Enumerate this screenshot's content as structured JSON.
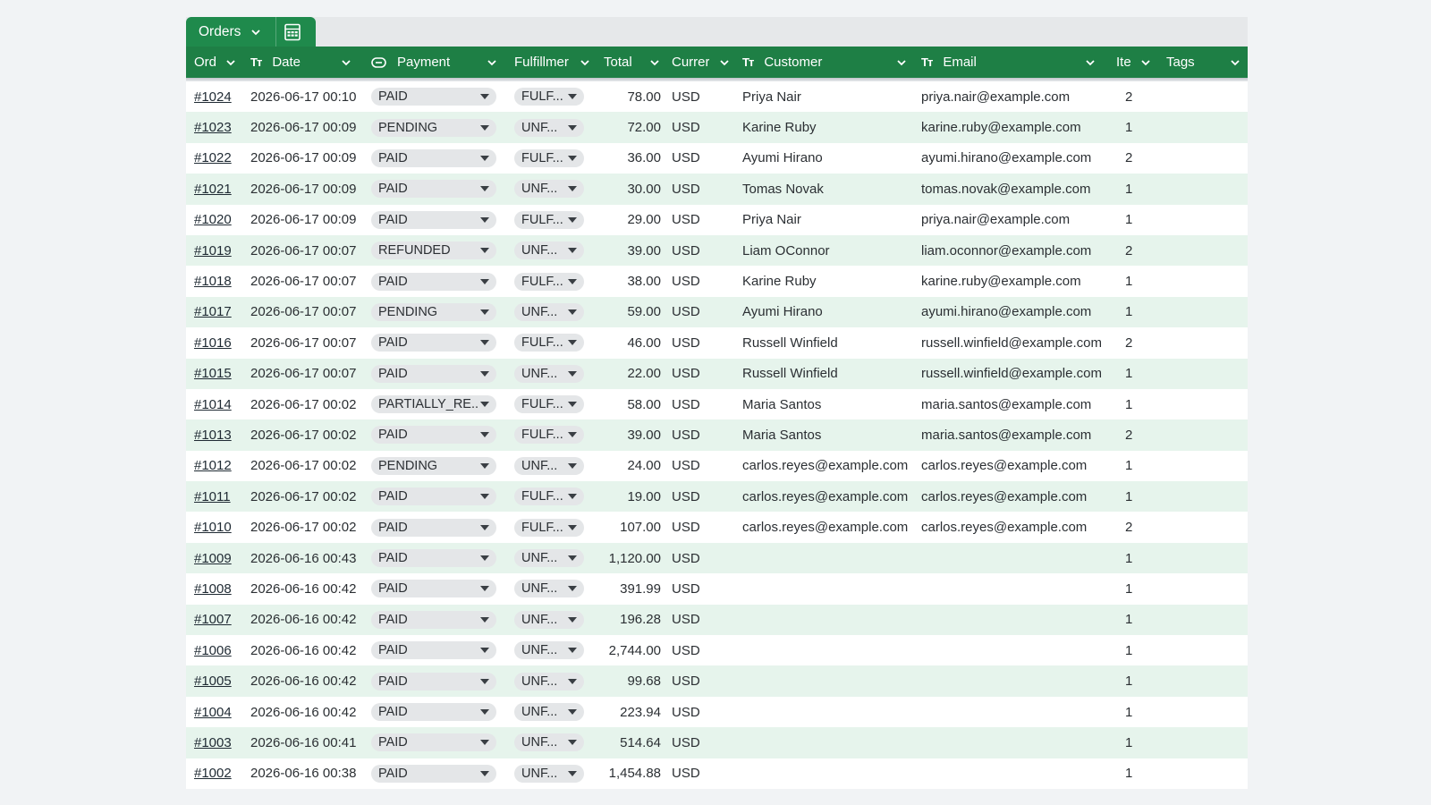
{
  "sheet_tab": {
    "label": "Orders"
  },
  "columns": [
    {
      "key": "order",
      "label": "Ord"
    },
    {
      "key": "date",
      "label": "Date"
    },
    {
      "key": "payment",
      "label": "Payment"
    },
    {
      "key": "fulfillment",
      "label": "Fulfillmer"
    },
    {
      "key": "total",
      "label": "Total"
    },
    {
      "key": "currency",
      "label": "Currer"
    },
    {
      "key": "customer",
      "label": "Customer"
    },
    {
      "key": "email",
      "label": "Email"
    },
    {
      "key": "items",
      "label": "Ite"
    },
    {
      "key": "tags",
      "label": "Tags"
    }
  ],
  "header_icons": {
    "date": "Tт",
    "customer": "Tт",
    "email": "Tт"
  },
  "rows": [
    {
      "order": "#1024",
      "date": "2026-06-17 00:10",
      "payment": "PAID",
      "fulfillment": "FULF...",
      "total": "78.00",
      "currency": "USD",
      "customer": "Priya Nair",
      "email": "priya.nair@example.com",
      "items": "2",
      "tags": ""
    },
    {
      "order": "#1023",
      "date": "2026-06-17 00:09",
      "payment": "PENDING",
      "fulfillment": "UNF...",
      "total": "72.00",
      "currency": "USD",
      "customer": "Karine Ruby",
      "email": "karine.ruby@example.com",
      "items": "1",
      "tags": ""
    },
    {
      "order": "#1022",
      "date": "2026-06-17 00:09",
      "payment": "PAID",
      "fulfillment": "FULF...",
      "total": "36.00",
      "currency": "USD",
      "customer": "Ayumi Hirano",
      "email": "ayumi.hirano@example.com",
      "items": "2",
      "tags": ""
    },
    {
      "order": "#1021",
      "date": "2026-06-17 00:09",
      "payment": "PAID",
      "fulfillment": "UNF...",
      "total": "30.00",
      "currency": "USD",
      "customer": "Tomas Novak",
      "email": "tomas.novak@example.com",
      "items": "1",
      "tags": ""
    },
    {
      "order": "#1020",
      "date": "2026-06-17 00:09",
      "payment": "PAID",
      "fulfillment": "FULF...",
      "total": "29.00",
      "currency": "USD",
      "customer": "Priya Nair",
      "email": "priya.nair@example.com",
      "items": "1",
      "tags": ""
    },
    {
      "order": "#1019",
      "date": "2026-06-17 00:07",
      "payment": "REFUNDED",
      "fulfillment": "UNF...",
      "total": "39.00",
      "currency": "USD",
      "customer": "Liam OConnor",
      "email": "liam.oconnor@example.com",
      "items": "2",
      "tags": ""
    },
    {
      "order": "#1018",
      "date": "2026-06-17 00:07",
      "payment": "PAID",
      "fulfillment": "FULF...",
      "total": "38.00",
      "currency": "USD",
      "customer": "Karine Ruby",
      "email": "karine.ruby@example.com",
      "items": "1",
      "tags": ""
    },
    {
      "order": "#1017",
      "date": "2026-06-17 00:07",
      "payment": "PENDING",
      "fulfillment": "UNF...",
      "total": "59.00",
      "currency": "USD",
      "customer": "Ayumi Hirano",
      "email": "ayumi.hirano@example.com",
      "items": "1",
      "tags": ""
    },
    {
      "order": "#1016",
      "date": "2026-06-17 00:07",
      "payment": "PAID",
      "fulfillment": "FULF...",
      "total": "46.00",
      "currency": "USD",
      "customer": "Russell Winfield",
      "email": "russell.winfield@example.com",
      "items": "2",
      "tags": ""
    },
    {
      "order": "#1015",
      "date": "2026-06-17 00:07",
      "payment": "PAID",
      "fulfillment": "UNF...",
      "total": "22.00",
      "currency": "USD",
      "customer": "Russell Winfield",
      "email": "russell.winfield@example.com",
      "items": "1",
      "tags": ""
    },
    {
      "order": "#1014",
      "date": "2026-06-17 00:02",
      "payment": "PARTIALLY_RE...",
      "fulfillment": "FULF...",
      "total": "58.00",
      "currency": "USD",
      "customer": "Maria Santos",
      "email": "maria.santos@example.com",
      "items": "1",
      "tags": ""
    },
    {
      "order": "#1013",
      "date": "2026-06-17 00:02",
      "payment": "PAID",
      "fulfillment": "FULF...",
      "total": "39.00",
      "currency": "USD",
      "customer": "Maria Santos",
      "email": "maria.santos@example.com",
      "items": "2",
      "tags": ""
    },
    {
      "order": "#1012",
      "date": "2026-06-17 00:02",
      "payment": "PENDING",
      "fulfillment": "UNF...",
      "total": "24.00",
      "currency": "USD",
      "customer": "carlos.reyes@example.com",
      "email": "carlos.reyes@example.com",
      "items": "1",
      "tags": ""
    },
    {
      "order": "#1011",
      "date": "2026-06-17 00:02",
      "payment": "PAID",
      "fulfillment": "FULF...",
      "total": "19.00",
      "currency": "USD",
      "customer": "carlos.reyes@example.com",
      "email": "carlos.reyes@example.com",
      "items": "1",
      "tags": ""
    },
    {
      "order": "#1010",
      "date": "2026-06-17 00:02",
      "payment": "PAID",
      "fulfillment": "FULF...",
      "total": "107.00",
      "currency": "USD",
      "customer": "carlos.reyes@example.com",
      "email": "carlos.reyes@example.com",
      "items": "2",
      "tags": ""
    },
    {
      "order": "#1009",
      "date": "2026-06-16 00:43",
      "payment": "PAID",
      "fulfillment": "UNF...",
      "total": "1,120.00",
      "currency": "USD",
      "customer": "",
      "email": "",
      "items": "1",
      "tags": ""
    },
    {
      "order": "#1008",
      "date": "2026-06-16 00:42",
      "payment": "PAID",
      "fulfillment": "UNF...",
      "total": "391.99",
      "currency": "USD",
      "customer": "",
      "email": "",
      "items": "1",
      "tags": ""
    },
    {
      "order": "#1007",
      "date": "2026-06-16 00:42",
      "payment": "PAID",
      "fulfillment": "UNF...",
      "total": "196.28",
      "currency": "USD",
      "customer": "",
      "email": "",
      "items": "1",
      "tags": ""
    },
    {
      "order": "#1006",
      "date": "2026-06-16 00:42",
      "payment": "PAID",
      "fulfillment": "UNF...",
      "total": "2,744.00",
      "currency": "USD",
      "customer": "",
      "email": "",
      "items": "1",
      "tags": ""
    },
    {
      "order": "#1005",
      "date": "2026-06-16 00:42",
      "payment": "PAID",
      "fulfillment": "UNF...",
      "total": "99.68",
      "currency": "USD",
      "customer": "",
      "email": "",
      "items": "1",
      "tags": ""
    },
    {
      "order": "#1004",
      "date": "2026-06-16 00:42",
      "payment": "PAID",
      "fulfillment": "UNF...",
      "total": "223.94",
      "currency": "USD",
      "customer": "",
      "email": "",
      "items": "1",
      "tags": ""
    },
    {
      "order": "#1003",
      "date": "2026-06-16 00:41",
      "payment": "PAID",
      "fulfillment": "UNF...",
      "total": "514.64",
      "currency": "USD",
      "customer": "",
      "email": "",
      "items": "1",
      "tags": ""
    },
    {
      "order": "#1002",
      "date": "2026-06-16 00:38",
      "payment": "PAID",
      "fulfillment": "UNF...",
      "total": "1,454.88",
      "currency": "USD",
      "customer": "",
      "email": "",
      "items": "1",
      "tags": ""
    }
  ],
  "colors": {
    "header_green": "#1e7f45",
    "tab_green": "#1f8a4c",
    "row_alt": "#e6f4ec",
    "pill_bg": "#e4e6e8"
  }
}
